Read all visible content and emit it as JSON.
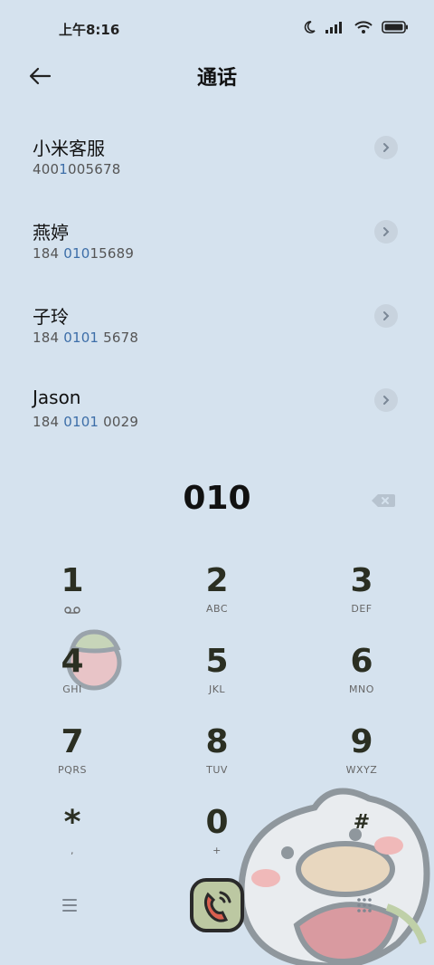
{
  "status": {
    "time": "上午8:16",
    "icons": [
      "moon-icon",
      "signal-icon",
      "wifi-icon",
      "battery-icon"
    ]
  },
  "header": {
    "title": "通话"
  },
  "contacts": [
    {
      "name": "小米客服",
      "num_pre": "400",
      "num_hl": "1",
      "num_post": "005678"
    },
    {
      "name": "燕婷",
      "num_pre": "184 ",
      "num_hl": "010",
      "num_post": "15689"
    },
    {
      "name": "子玲",
      "num_pre": "184 ",
      "num_hl": "0101",
      "num_post": " 5678"
    },
    {
      "name": "Jason",
      "num_pre": "184 ",
      "num_hl": "0101",
      "num_post": " 0029"
    }
  ],
  "dialed": "010",
  "keys": [
    {
      "digit": "1",
      "letters": ""
    },
    {
      "digit": "2",
      "letters": "ABC"
    },
    {
      "digit": "3",
      "letters": "DEF"
    },
    {
      "digit": "4",
      "letters": "GHI"
    },
    {
      "digit": "5",
      "letters": "JKL"
    },
    {
      "digit": "6",
      "letters": "MNO"
    },
    {
      "digit": "7",
      "letters": "PQRS"
    },
    {
      "digit": "8",
      "letters": "TUV"
    },
    {
      "digit": "9",
      "letters": "WXYZ"
    },
    {
      "digit": "*",
      "letters": ","
    },
    {
      "digit": "0",
      "letters": "+"
    },
    {
      "digit": "#",
      "letters": ""
    }
  ],
  "colors": {
    "background": "#d5e2ee",
    "highlight": "#3d6ea8",
    "call_button": "#d9604f"
  }
}
